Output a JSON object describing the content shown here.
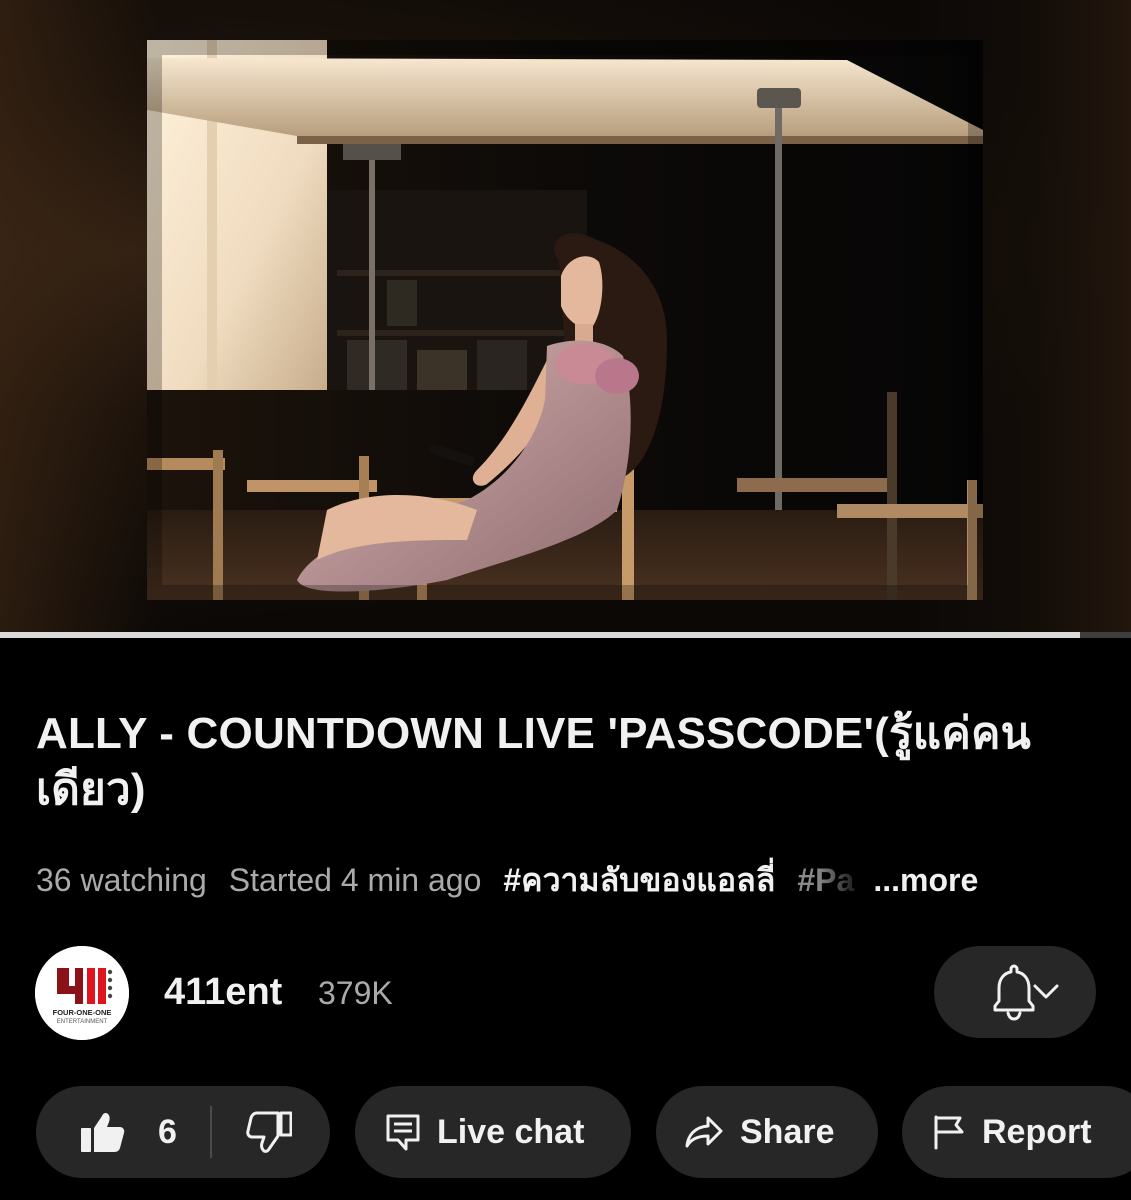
{
  "video": {
    "progress_percent": 95.5
  },
  "info": {
    "title": "ALLY - COUNTDOWN LIVE  'PASSCODE'(รู้แค่คนเดียว)",
    "watching": "36 watching",
    "started": "Started 4 min ago",
    "hashtag_1": "#ความลับของแอลลี่",
    "hashtag_2": "#Pa",
    "more_label": "...more"
  },
  "channel": {
    "avatar_logo_text": "4II",
    "avatar_logo_caption": "FOUR-ONE-ONE",
    "avatar_logo_subcaption": "ENTERTAINMENT",
    "name": "411ent",
    "subscribers": "379K",
    "bell_icon": "bell-icon",
    "chevron_icon": "chevron-down-icon"
  },
  "actions": {
    "like_count": "6",
    "like_icon": "thumbs-up-icon",
    "dislike_icon": "thumbs-down-icon",
    "live_chat_label": "Live chat",
    "share_label": "Share",
    "report_label": "Report"
  }
}
